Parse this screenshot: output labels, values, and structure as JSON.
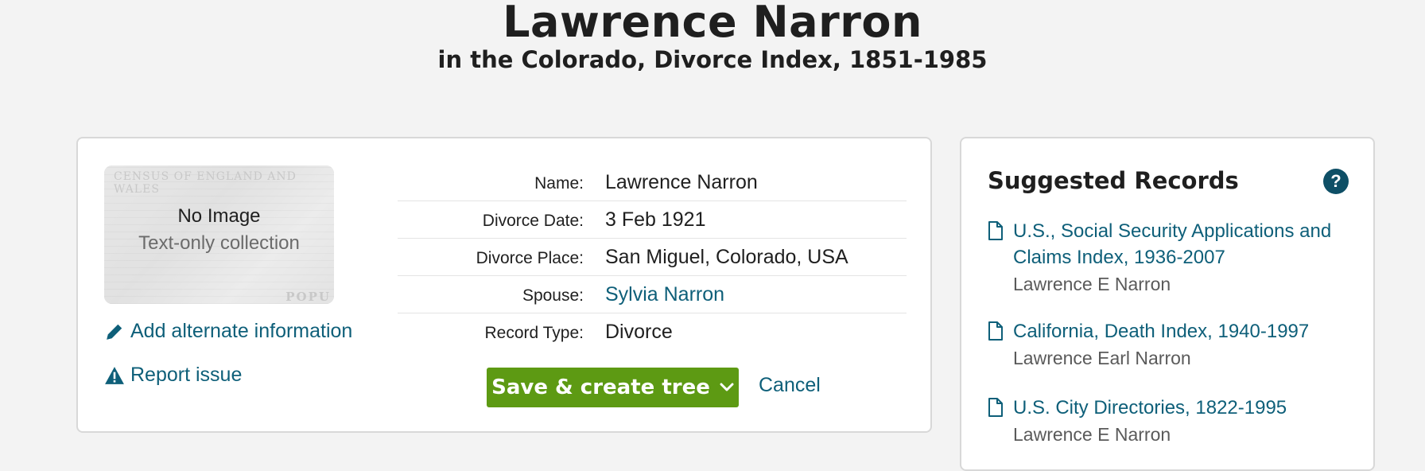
{
  "header": {
    "title": "Lawrence Narron",
    "subtitle": "in the Colorado, Divorce Index, 1851-1985"
  },
  "image_tile": {
    "bg_text_top": "CENSUS OF ENGLAND AND WALES",
    "bg_text_bottom": "POPU",
    "no_image": "No Image",
    "text_only": "Text-only collection"
  },
  "actions": {
    "add_alternate": "Add alternate information",
    "report_issue": "Report issue",
    "save_label": "Save & create tree",
    "cancel_label": "Cancel"
  },
  "fields": [
    {
      "label": "Name:",
      "value": "Lawrence Narron"
    },
    {
      "label": "Divorce Date:",
      "value": "3 Feb 1921"
    },
    {
      "label": "Divorce Place:",
      "value": "San Miguel, Colorado, USA"
    },
    {
      "label": "Spouse:",
      "value": "Sylvia Narron"
    },
    {
      "label": "Record Type:",
      "value": "Divorce"
    }
  ],
  "suggested": {
    "title": "Suggested Records",
    "help": "?",
    "items": [
      {
        "title": "U.S., Social Security Applications and Claims Index, 1936-2007",
        "person": "Lawrence E Narron"
      },
      {
        "title": "California, Death Index, 1940-1997",
        "person": "Lawrence Earl Narron"
      },
      {
        "title": "U.S. City Directories, 1822-1995",
        "person": "Lawrence E Narron"
      }
    ]
  },
  "colors": {
    "link": "#0e5f79",
    "save_button": "#5d9a13",
    "help_icon": "#0e4f66",
    "background": "#f3f3f3"
  },
  "icons": {
    "add": "pencil-icon",
    "report": "warning-icon",
    "save_dropdown": "chevron-down-icon",
    "help": "help-icon",
    "record": "document-icon"
  }
}
